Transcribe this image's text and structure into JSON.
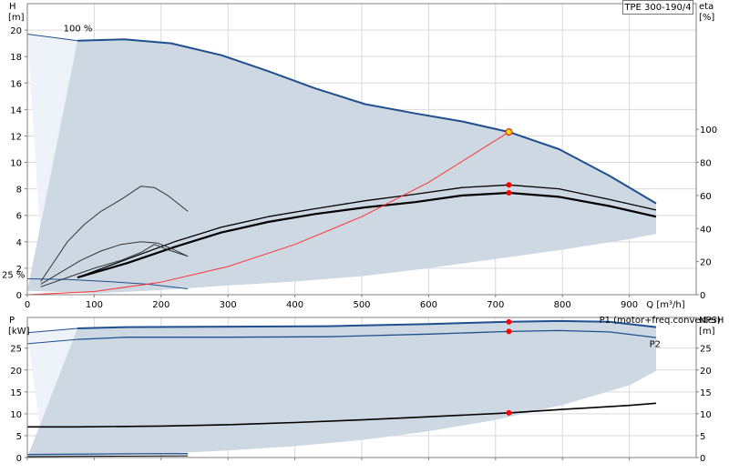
{
  "model_label": "TPE 300-190/4",
  "colors": {
    "envelope_fill": "#cdd8e3",
    "light_fill": "#eef3fa",
    "curve_blue": "#1f4f8f",
    "curve_black": "#000000",
    "system_curve": "#ff3333",
    "duty_point": "#ff0000",
    "duty_point_top": "#ffd700"
  },
  "chart_data": [
    {
      "type": "line",
      "panel": "head-efficiency",
      "x_label": "Q [m³/h]",
      "y_label_top": "H",
      "y_label_unit": "[m]",
      "y2_label_top": "eta",
      "y2_label_unit": "[%]",
      "xlim": [
        0,
        1000
      ],
      "ylim": [
        0,
        22
      ],
      "y2lim": [
        0,
        176
      ],
      "x_ticks": [
        0,
        100,
        200,
        300,
        400,
        500,
        600,
        700,
        800,
        900
      ],
      "y_ticks": [
        0,
        2,
        4,
        6,
        8,
        10,
        12,
        14,
        16,
        18,
        20
      ],
      "y2_ticks": [
        0,
        20,
        40,
        60,
        80,
        100
      ],
      "grid": true,
      "curve_labels": [
        "100 %",
        "25 %"
      ],
      "envelope_upper": [
        [
          75,
          19.2
        ],
        [
          145,
          19.3
        ],
        [
          215,
          19.0
        ],
        [
          290,
          18.1
        ],
        [
          360,
          16.9
        ],
        [
          430,
          15.6
        ],
        [
          505,
          14.4
        ],
        [
          580,
          13.7
        ],
        [
          650,
          13.1
        ],
        [
          720,
          12.3
        ],
        [
          795,
          11.0
        ],
        [
          870,
          9.0
        ],
        [
          940,
          6.9
        ]
      ],
      "envelope_lower": [
        [
          0,
          0.3
        ],
        [
          100,
          0.1
        ],
        [
          200,
          0.35
        ],
        [
          300,
          0.7
        ],
        [
          400,
          1.0
        ],
        [
          500,
          1.4
        ],
        [
          600,
          2.0
        ],
        [
          700,
          2.7
        ],
        [
          800,
          3.4
        ],
        [
          900,
          4.2
        ],
        [
          940,
          4.6
        ]
      ],
      "light_region_upper": [
        [
          0,
          19.7
        ],
        [
          75,
          19.2
        ],
        [
          50,
          5
        ],
        [
          25,
          0
        ]
      ],
      "series": [
        {
          "role": "head-max",
          "points": [
            [
              75,
              19.2
            ],
            [
              145,
              19.3
            ],
            [
              215,
              19.0
            ],
            [
              290,
              18.1
            ],
            [
              360,
              16.9
            ],
            [
              430,
              15.6
            ],
            [
              505,
              14.4
            ],
            [
              580,
              13.7
            ],
            [
              650,
              13.1
            ],
            [
              720,
              12.3
            ],
            [
              795,
              11.0
            ],
            [
              870,
              9.0
            ],
            [
              940,
              6.9
            ]
          ]
        },
        {
          "role": "head-max-thin",
          "points": [
            [
              0,
              19.7
            ],
            [
              75,
              19.2
            ]
          ]
        },
        {
          "role": "head-min",
          "points": [
            [
              0,
              1.2
            ],
            [
              60,
              1.15
            ],
            [
              120,
              1.0
            ],
            [
              180,
              0.8
            ],
            [
              240,
              0.45
            ]
          ]
        },
        {
          "role": "efficiency-pump",
          "points": [
            [
              75,
              1.3
            ],
            [
              150,
              2.7
            ],
            [
              220,
              4.0
            ],
            [
              290,
              5.1
            ],
            [
              360,
              5.9
            ],
            [
              430,
              6.5
            ],
            [
              505,
              7.1
            ],
            [
              580,
              7.6
            ],
            [
              650,
              8.1
            ],
            [
              720,
              8.3
            ],
            [
              795,
              8.0
            ],
            [
              870,
              7.2
            ],
            [
              940,
              6.4
            ]
          ]
        },
        {
          "role": "efficiency-total",
          "points": [
            [
              75,
              1.3
            ],
            [
              150,
              2.4
            ],
            [
              220,
              3.6
            ],
            [
              290,
              4.7
            ],
            [
              360,
              5.5
            ],
            [
              430,
              6.1
            ],
            [
              505,
              6.6
            ],
            [
              580,
              7.0
            ],
            [
              650,
              7.5
            ],
            [
              720,
              7.7
            ],
            [
              795,
              7.4
            ],
            [
              870,
              6.7
            ],
            [
              940,
              5.9
            ]
          ]
        },
        {
          "role": "efficiency-min-a",
          "points": [
            [
              20,
              1.0
            ],
            [
              40,
              2.5
            ],
            [
              60,
              4.0
            ],
            [
              85,
              5.3
            ],
            [
              110,
              6.3
            ],
            [
              140,
              7.2
            ],
            [
              170,
              8.2
            ],
            [
              190,
              8.1
            ],
            [
              210,
              7.5
            ],
            [
              240,
              6.3
            ]
          ]
        },
        {
          "role": "efficiency-min-b",
          "points": [
            [
              20,
              0.8
            ],
            [
              50,
              1.7
            ],
            [
              80,
              2.6
            ],
            [
              110,
              3.3
            ],
            [
              140,
              3.8
            ],
            [
              170,
              4.0
            ],
            [
              195,
              3.9
            ],
            [
              215,
              3.5
            ],
            [
              240,
              2.9
            ]
          ]
        },
        {
          "role": "efficiency-min-c",
          "points": [
            [
              20,
              0.6
            ],
            [
              60,
              1.3
            ],
            [
              100,
              2.0
            ],
            [
              140,
              2.6
            ],
            [
              170,
              3.2
            ],
            [
              190,
              3.8
            ],
            [
              210,
              3.4
            ],
            [
              240,
              2.9
            ]
          ]
        },
        {
          "role": "system-curve",
          "points": [
            [
              0,
              0
            ],
            [
              100,
              0.24
            ],
            [
              200,
              0.95
            ],
            [
              300,
              2.13
            ],
            [
              400,
              3.8
            ],
            [
              500,
              5.9
            ],
            [
              600,
              8.5
            ],
            [
              720,
              12.3
            ]
          ]
        }
      ],
      "duty_points": [
        {
          "x": 720,
          "y": 12.3,
          "style": "top"
        },
        {
          "x": 720,
          "y": 8.3,
          "style": "point"
        },
        {
          "x": 720,
          "y": 7.7,
          "style": "point"
        }
      ]
    },
    {
      "type": "line",
      "panel": "power-npsh",
      "y_label_top": "P",
      "y_label_unit": "[kW]",
      "y2_label_top": "NPSH",
      "y2_label_unit": "[m]",
      "xlim": [
        0,
        1000
      ],
      "ylim": [
        0,
        32
      ],
      "y2lim": [
        0,
        32
      ],
      "x_ticks": [
        0,
        100,
        200,
        300,
        400,
        500,
        600,
        700,
        800,
        900
      ],
      "y_ticks": [
        0,
        5,
        10,
        15,
        20,
        25
      ],
      "y2_ticks": [
        0,
        5,
        10,
        15,
        20,
        25
      ],
      "grid": true,
      "envelope_upper": [
        [
          75,
          29.5
        ],
        [
          150,
          29.8
        ],
        [
          300,
          29.9
        ],
        [
          450,
          30.0
        ],
        [
          600,
          30.5
        ],
        [
          720,
          31.0
        ],
        [
          795,
          31.2
        ],
        [
          870,
          31.0
        ],
        [
          940,
          29.8
        ]
      ],
      "envelope_lower": [
        [
          0,
          0.0
        ],
        [
          100,
          0.4
        ],
        [
          200,
          0.9
        ],
        [
          300,
          1.6
        ],
        [
          400,
          2.6
        ],
        [
          500,
          4.0
        ],
        [
          600,
          6.0
        ],
        [
          700,
          8.6
        ],
        [
          800,
          12.0
        ],
        [
          900,
          16.5
        ],
        [
          940,
          19.8
        ]
      ],
      "light_region_upper": [
        [
          0,
          28.5
        ],
        [
          75,
          29.5
        ],
        [
          50,
          9
        ],
        [
          25,
          0
        ]
      ],
      "series_labels": [
        "P1 (motor+freq.converter)",
        "P2"
      ],
      "series": [
        {
          "name": "P1 (motor+freq.converter)",
          "role": "p1",
          "points": [
            [
              75,
              29.5
            ],
            [
              150,
              29.8
            ],
            [
              300,
              29.9
            ],
            [
              450,
              30.0
            ],
            [
              600,
              30.5
            ],
            [
              720,
              31.0
            ],
            [
              795,
              31.2
            ],
            [
              870,
              31.0
            ],
            [
              940,
              29.8
            ]
          ]
        },
        {
          "role": "p1-thin",
          "points": [
            [
              0,
              28.5
            ],
            [
              75,
              29.5
            ]
          ]
        },
        {
          "name": "P2",
          "role": "p2",
          "points": [
            [
              75,
              27.0
            ],
            [
              150,
              27.5
            ],
            [
              300,
              27.5
            ],
            [
              450,
              27.6
            ],
            [
              600,
              28.2
            ],
            [
              720,
              28.8
            ],
            [
              795,
              29.0
            ],
            [
              870,
              28.7
            ],
            [
              940,
              27.4
            ]
          ]
        },
        {
          "role": "p2-thin",
          "points": [
            [
              0,
              26.0
            ],
            [
              75,
              27.0
            ]
          ]
        },
        {
          "role": "npsh",
          "points": [
            [
              0,
              7.0
            ],
            [
              75,
              7.0
            ],
            [
              200,
              7.2
            ],
            [
              300,
              7.5
            ],
            [
              400,
              8.0
            ],
            [
              500,
              8.6
            ],
            [
              600,
              9.3
            ],
            [
              720,
              10.2
            ],
            [
              800,
              11.0
            ],
            [
              900,
              11.9
            ],
            [
              940,
              12.4
            ]
          ]
        },
        {
          "role": "p-min-a",
          "points": [
            [
              0,
              0.7
            ],
            [
              100,
              0.8
            ],
            [
              240,
              0.9
            ]
          ]
        },
        {
          "role": "p-min-b",
          "points": [
            [
              0,
              0.2
            ],
            [
              100,
              0.3
            ],
            [
              240,
              0.4
            ]
          ]
        }
      ],
      "duty_points": [
        {
          "x": 720,
          "y": 31.0,
          "style": "point"
        },
        {
          "x": 720,
          "y": 28.8,
          "style": "point"
        },
        {
          "x": 720,
          "y": 10.2,
          "style": "point"
        }
      ]
    }
  ]
}
